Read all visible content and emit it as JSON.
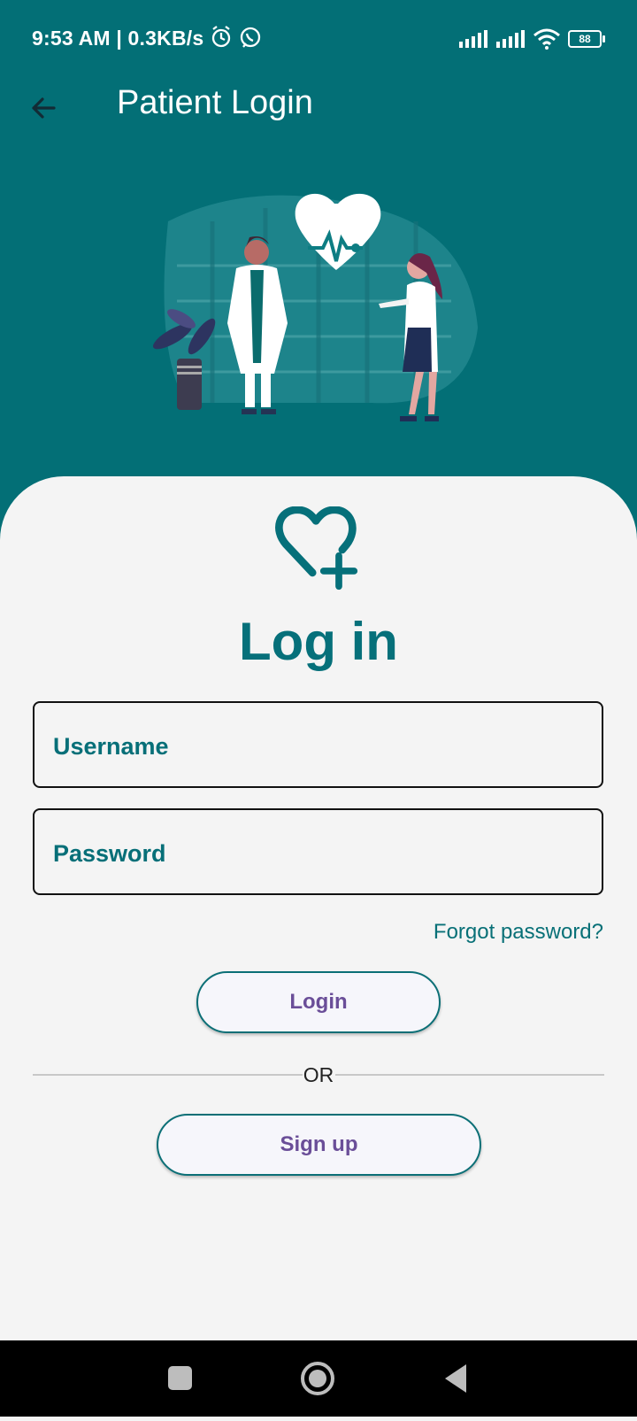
{
  "status_bar": {
    "time_speed": "9:53 AM | 0.3KB/s",
    "battery": "88",
    "icons": [
      "alarm-icon",
      "whatsapp-icon",
      "signal-icon",
      "signal-icon",
      "wifi-icon",
      "battery-icon"
    ]
  },
  "app_bar": {
    "title": "Patient Login",
    "back_icon": "arrow-left-icon"
  },
  "form": {
    "heading": "Log in",
    "username_label": "Username",
    "password_label": "Password",
    "forgot_link": "Forgot password?",
    "login_button": "Login",
    "or_text": "OR",
    "signup_button": "Sign up"
  },
  "colors": {
    "brand": "#036f76",
    "button_text": "#6a4e98",
    "background": "#f4f4f4"
  }
}
